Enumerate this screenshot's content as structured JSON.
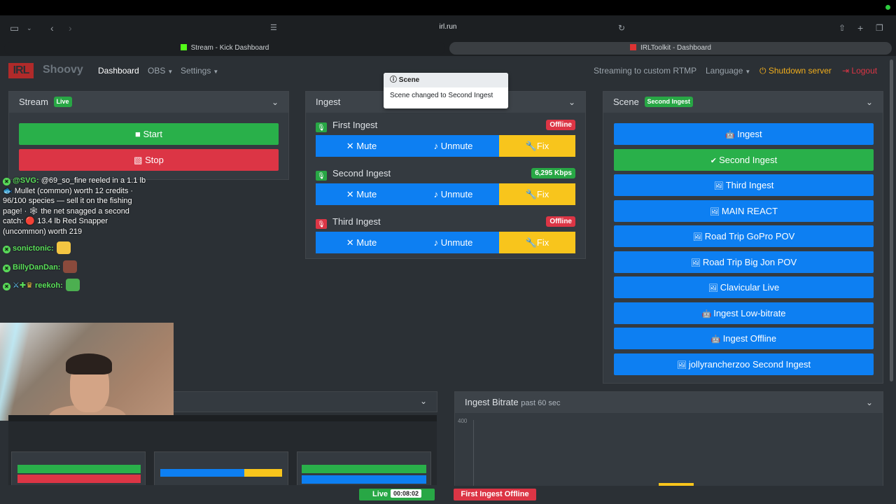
{
  "browser": {
    "url": "irl.run",
    "tabs": [
      {
        "label": "Stream - Kick Dashboard",
        "fav_color": "#53fc18"
      },
      {
        "label": "IRLToolkit - Dashboard",
        "fav_color": "#d33"
      }
    ]
  },
  "nav": {
    "logo": "IRL",
    "brand": "Shoovy",
    "dashboard": "Dashboard",
    "obs": "OBS",
    "settings": "Settings",
    "streaming_info": "Streaming to custom RTMP",
    "language": "Language",
    "shutdown": "Shutdown server",
    "logout": "Logout"
  },
  "stream_card": {
    "title": "Stream",
    "badge": "Live",
    "start": "Start",
    "stop": "Stop"
  },
  "ingest_card": {
    "title": "Ingest",
    "ingests": [
      {
        "name": "First Ingest",
        "status": "Offline",
        "status_color": "#dc3545",
        "mic_color": "#28a745",
        "mute": "Mute",
        "unmute": "Unmute",
        "fix": "Fix"
      },
      {
        "name": "Second Ingest",
        "status": "6,295 Kbps",
        "status_color": "#28a745",
        "mic_color": "#28a745",
        "mute": "Mute",
        "unmute": "Unmute",
        "fix": "Fix"
      },
      {
        "name": "Third Ingest",
        "status": "Offline",
        "status_color": "#dc3545",
        "mic_color": "#dc3545",
        "mute": "Mute",
        "unmute": "Unmute",
        "fix": "Fix"
      }
    ]
  },
  "toast": {
    "title": "Scene",
    "body": "Scene changed to Second Ingest"
  },
  "scene_card": {
    "title": "Scene",
    "badge": "Second Ingest",
    "scenes": [
      {
        "label": "Ingest",
        "icon": "robot-icon",
        "active": false
      },
      {
        "label": "Second Ingest",
        "icon": "check-icon",
        "active": true
      },
      {
        "label": "Third Ingest",
        "icon": "image-icon",
        "active": false
      },
      {
        "label": "MAIN REACT",
        "icon": "image-icon",
        "active": false
      },
      {
        "label": "Road Trip GoPro POV",
        "icon": "image-icon",
        "active": false
      },
      {
        "label": "Road Trip Big Jon POV",
        "icon": "image-icon",
        "active": false
      },
      {
        "label": "Clavicular Live",
        "icon": "image-icon",
        "active": false
      },
      {
        "label": "Ingest Low-bitrate",
        "icon": "robot-icon",
        "active": false
      },
      {
        "label": "Ingest Offline",
        "icon": "robot-icon",
        "active": false
      },
      {
        "label": "jollyrancherzoo Second Ingest",
        "icon": "image-icon",
        "active": false
      }
    ]
  },
  "chat": [
    {
      "user": "@SVG:",
      "text": "@69_so_fine reeled in a 1.1 lb 🐟 Mullet (common) worth 12 credits · 96/100 species — sell it on the fishing page! · 🕸 the net snagged a second catch: 🔴 13.4 lb Red Snapper (uncommon) worth 219"
    },
    {
      "user": "sonictonic:",
      "text": ""
    },
    {
      "user": "BillyDanDan:",
      "text": ""
    },
    {
      "user": "reekoh:",
      "text": ""
    }
  ],
  "bitrate_card": {
    "title": "Ingest Bitrate",
    "subtitle": "past 60 sec",
    "y_tick": "400"
  },
  "bottom": {
    "live": "Live",
    "timer": "00:08:02",
    "alert": "First Ingest Offline"
  },
  "colors": {
    "green": "#29b04a",
    "red": "#dc3545",
    "blue": "#0d7ff2",
    "yellow": "#f8c51c"
  }
}
